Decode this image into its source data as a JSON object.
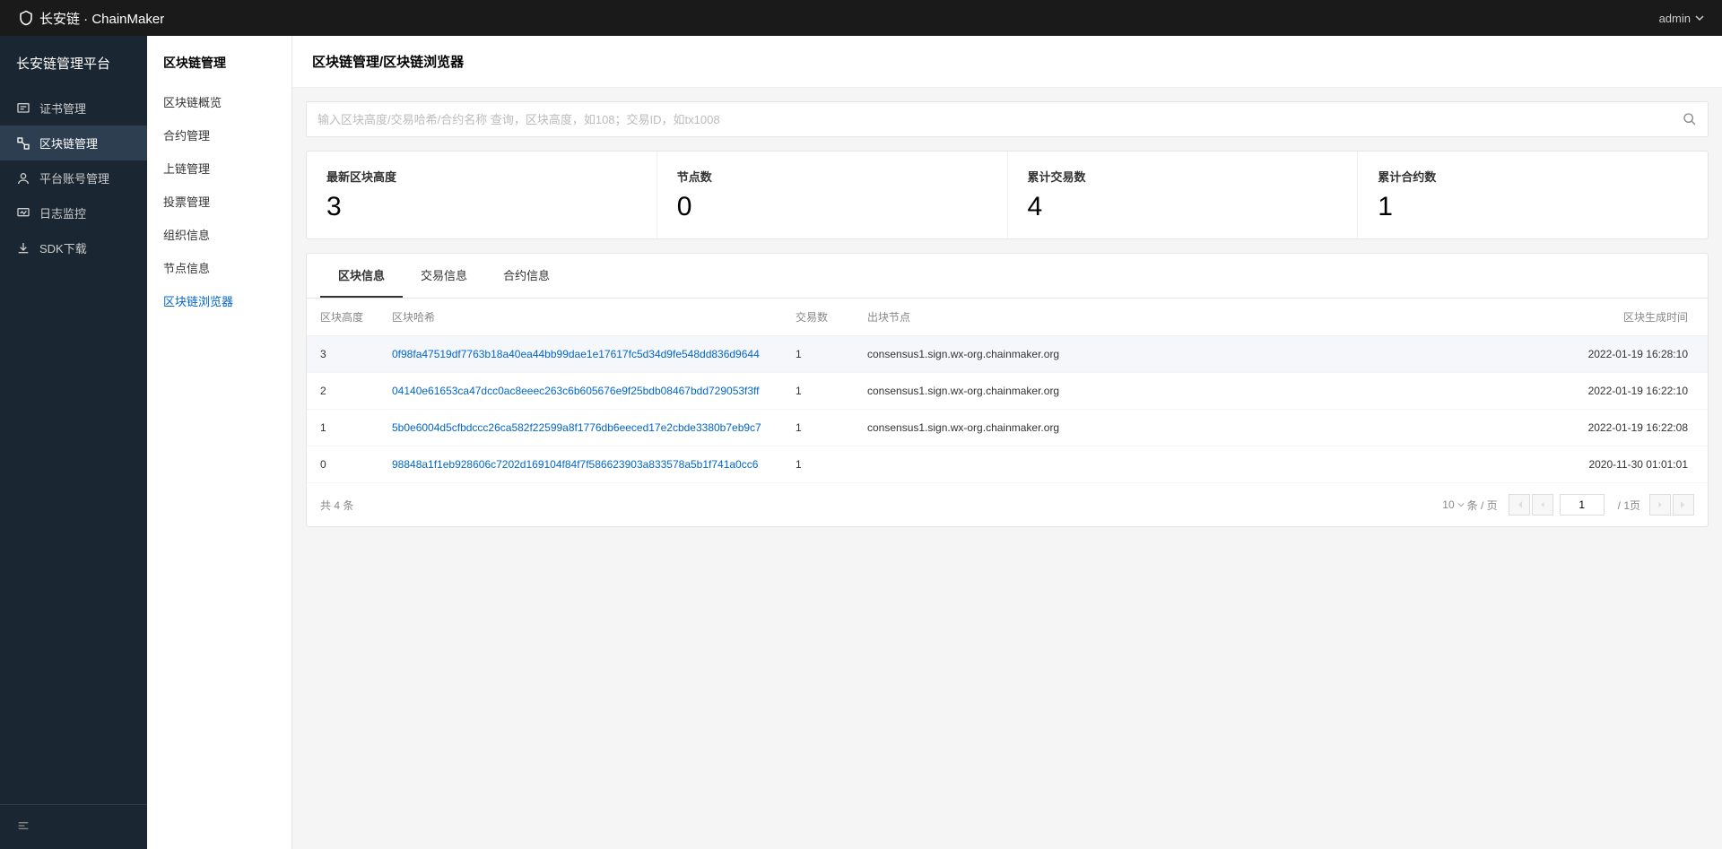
{
  "header": {
    "logo_text": "长安链 · ChainMaker",
    "user": "admin"
  },
  "sidebar1": {
    "title": "长安链管理平台",
    "items": [
      {
        "label": "证书管理"
      },
      {
        "label": "区块链管理"
      },
      {
        "label": "平台账号管理"
      },
      {
        "label": "日志监控"
      },
      {
        "label": "SDK下载"
      }
    ]
  },
  "sidebar2": {
    "title": "区块链管理",
    "items": [
      {
        "label": "区块链概览"
      },
      {
        "label": "合约管理"
      },
      {
        "label": "上链管理"
      },
      {
        "label": "投票管理"
      },
      {
        "label": "组织信息"
      },
      {
        "label": "节点信息"
      },
      {
        "label": "区块链浏览器"
      }
    ]
  },
  "breadcrumb": "区块链管理/区块链浏览器",
  "search": {
    "placeholder": "输入区块高度/交易哈希/合约名称 查询，区块高度，如108；交易ID，如tx1008"
  },
  "stats": [
    {
      "label": "最新区块高度",
      "value": "3"
    },
    {
      "label": "节点数",
      "value": "0"
    },
    {
      "label": "累计交易数",
      "value": "4"
    },
    {
      "label": "累计合约数",
      "value": "1"
    }
  ],
  "tabs": [
    {
      "label": "区块信息"
    },
    {
      "label": "交易信息"
    },
    {
      "label": "合约信息"
    }
  ],
  "table": {
    "headers": {
      "height": "区块高度",
      "hash": "区块哈希",
      "tx": "交易数",
      "node": "出块节点",
      "time": "区块生成时间"
    },
    "rows": [
      {
        "height": "3",
        "hash": "0f98fa47519df7763b18a40ea44bb99dae1e17617fc5d34d9fe548dd836d9644",
        "tx": "1",
        "node": "consensus1.sign.wx-org.chainmaker.org",
        "time": "2022-01-19 16:28:10"
      },
      {
        "height": "2",
        "hash": "04140e61653ca47dcc0ac8eeec263c6b605676e9f25bdb08467bdd729053f3ff",
        "tx": "1",
        "node": "consensus1.sign.wx-org.chainmaker.org",
        "time": "2022-01-19 16:22:10"
      },
      {
        "height": "1",
        "hash": "5b0e6004d5cfbdccc26ca582f22599a8f1776db6eeced17e2cbde3380b7eb9c7",
        "tx": "1",
        "node": "consensus1.sign.wx-org.chainmaker.org",
        "time": "2022-01-19 16:22:08"
      },
      {
        "height": "0",
        "hash": "98848a1f1eb928606c7202d169104f84f7f586623903a833578a5b1f741a0cc6",
        "tx": "1",
        "node": "",
        "time": "2020-11-30 01:01:01"
      }
    ]
  },
  "pagination": {
    "total_text": "共 4 条",
    "page_size": "10",
    "per_page_label": "条 / 页",
    "current": "1",
    "total_pages": "/ 1页"
  }
}
